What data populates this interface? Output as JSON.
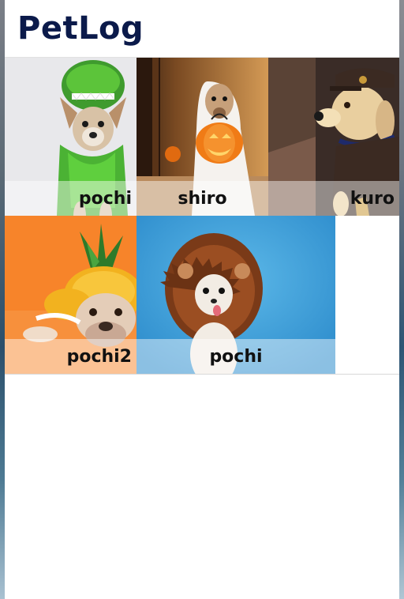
{
  "app": {
    "title": "PetLog"
  },
  "pets": [
    {
      "name": "pochi",
      "photo_desc": "chihuahua-in-dinosaur-costume",
      "bg": "#e9e9ec"
    },
    {
      "name": "shiro",
      "photo_desc": "dog-in-ghost-costume-with-pumpkin",
      "bg": "#8a5a2a"
    },
    {
      "name": "kuro",
      "photo_desc": "labrador-in-delivery-uniform",
      "bg": "#3e2f2a"
    },
    {
      "name": "pochi2",
      "photo_desc": "bulldog-in-pineapple-costume",
      "bg": "#f7862c"
    },
    {
      "name": "pochi",
      "photo_desc": "chihuahua-in-lion-mane",
      "bg": "#3fa2d8"
    }
  ]
}
